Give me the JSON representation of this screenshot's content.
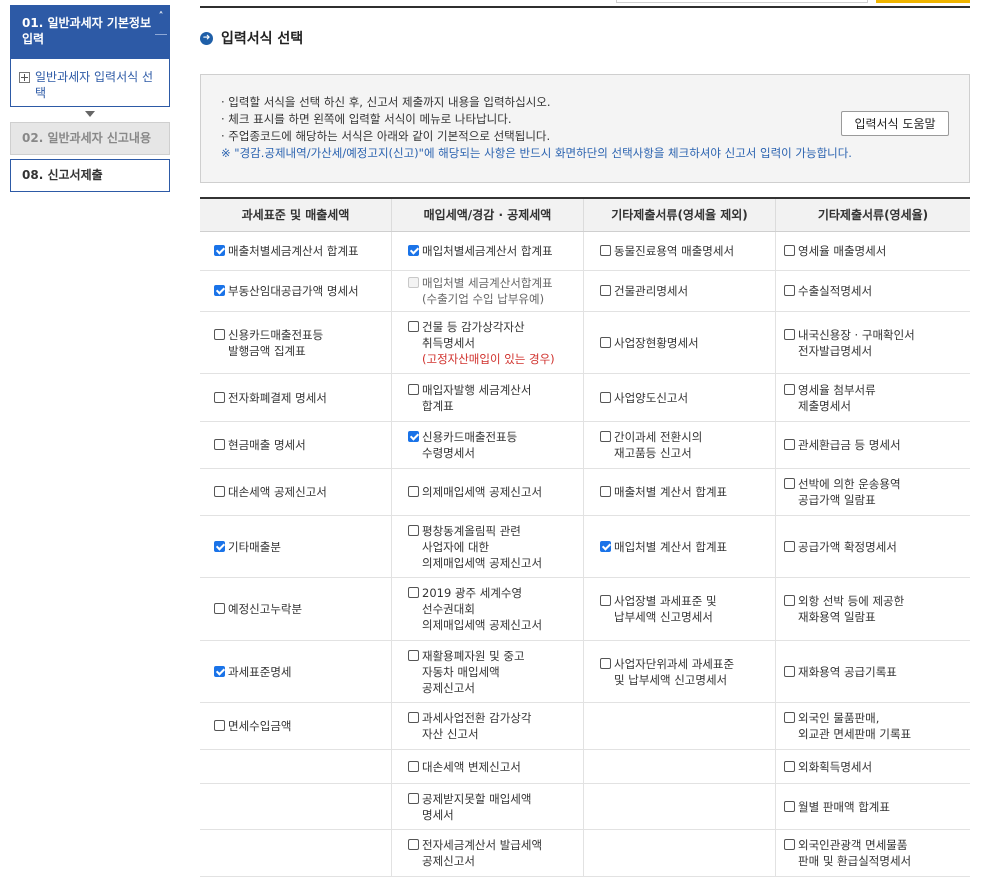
{
  "sidebar": {
    "step1": {
      "num": "01.",
      "label": "일반과세자 기본정보입력",
      "sub_item": "일반과세자 입력서식 선택",
      "collapse_icon": "chevron-up-icon"
    },
    "step2": {
      "num": "02.",
      "label": "일반과세자 신고내용"
    },
    "step8": {
      "num": "08.",
      "label": "신고서제출"
    }
  },
  "section_title": "입력서식 선택",
  "info": {
    "lines": [
      "· 입력할 서식을 선택 하신 후, 신고서 제출까지 내용을 입력하십시오.",
      "· 체크 표시를 하면 왼쪽에 입력할 서식이 메뉴로 나타납니다.",
      "· 주업종코드에 해당하는 서식은 아래와 같이 기본적으로 선택됩니다."
    ],
    "note": "※ \"경감.공제내역/가산세/예정고지(신고)\"에 해당되는 사항은 반드시 화면하단의 선택사항을 체크하셔야 신고서 입력이 가능합니다.",
    "help_button": "입력서식 도움말"
  },
  "colors": {
    "accent": "#2d5aa6",
    "checkbox": "#1a73e8",
    "warning_red": "#d0312d",
    "note_blue": "#2b63b0"
  },
  "table": {
    "headers": [
      "과세표준 및 매출세액",
      "매입세액/경감 · 공제세액",
      "기타제출서류(영세율 제외)",
      "기타제출서류(영세율)"
    ],
    "rows": [
      {
        "h": 38,
        "cells": [
          {
            "lines": [
              "매출처별세금계산서 합계표"
            ],
            "checked": true
          },
          {
            "lines": [
              "매입처별세금계산서 합계표"
            ],
            "checked": true
          },
          {
            "lines": [
              "동물진료용역 매출명세서"
            ],
            "checked": false
          },
          {
            "lines": [
              "영세율 매출명세서"
            ],
            "checked": false
          }
        ]
      },
      {
        "h": 40,
        "cells": [
          {
            "lines": [
              "부동산임대공급가액 명세서"
            ],
            "checked": true
          },
          {
            "lines": [
              "매입처별 세금계산서합계표",
              "(수출기업 수입 납부유예)"
            ],
            "checked": false,
            "disabled": true
          },
          {
            "lines": [
              "건물관리명세서"
            ],
            "checked": false
          },
          {
            "lines": [
              "수출실적명세서"
            ],
            "checked": false
          }
        ]
      },
      {
        "h": 61,
        "cells": [
          {
            "lines": [
              "신용카드매출전표등",
              "발행금액 집계표"
            ],
            "checked": false
          },
          {
            "lines": [
              "건물 등 감가상각자산",
              "취득명세서"
            ],
            "red": "(고정자산매입이 있는 경우)",
            "checked": false
          },
          {
            "lines": [
              "사업장현황명세서"
            ],
            "checked": false
          },
          {
            "lines": [
              "내국신용장 · 구매확인서",
              "전자발급명세서"
            ],
            "checked": false
          }
        ]
      },
      {
        "h": 47,
        "cells": [
          {
            "lines": [
              "전자화폐결제 명세서"
            ],
            "checked": false
          },
          {
            "lines": [
              "매입자발행 세금계산서",
              "합계표"
            ],
            "checked": false
          },
          {
            "lines": [
              "사업양도신고서"
            ],
            "checked": false
          },
          {
            "lines": [
              "영세율 첨부서류",
              "제출명세서"
            ],
            "checked": false
          }
        ]
      },
      {
        "h": 46,
        "cells": [
          {
            "lines": [
              "현금매출 명세서"
            ],
            "checked": false
          },
          {
            "lines": [
              "신용카드매출전표등",
              "수령명세서"
            ],
            "checked": true
          },
          {
            "lines": [
              "간이과세 전환시의",
              "재고품등 신고서"
            ],
            "checked": false
          },
          {
            "lines": [
              "관세환급금 등 명세서"
            ],
            "checked": false
          }
        ]
      },
      {
        "h": 46,
        "cells": [
          {
            "lines": [
              "대손세액 공제신고서"
            ],
            "checked": false
          },
          {
            "lines": [
              "의제매입세액 공제신고서"
            ],
            "checked": false
          },
          {
            "lines": [
              "매출처별 계산서 합계표"
            ],
            "checked": false
          },
          {
            "lines": [
              "선박에 의한 운송용역",
              "공급가액 일람표"
            ],
            "checked": false
          }
        ]
      },
      {
        "h": 61,
        "cells": [
          {
            "lines": [
              "기타매출분"
            ],
            "checked": true
          },
          {
            "lines": [
              "평창동계올림픽 관련",
              "사업자에 대한",
              "의제매입세액 공제신고서"
            ],
            "checked": false
          },
          {
            "lines": [
              "매입처별 계산서 합계표"
            ],
            "checked": true
          },
          {
            "lines": [
              "공급가액 확정명세서"
            ],
            "checked": false
          }
        ]
      },
      {
        "h": 62,
        "cells": [
          {
            "lines": [
              "예정신고누락분"
            ],
            "checked": false
          },
          {
            "lines": [
              "2019 광주 세계수영",
              "선수권대회",
              "의제매입세액 공제신고서"
            ],
            "checked": false
          },
          {
            "lines": [
              "사업장별 과세표준 및",
              "납부세액 신고명세서"
            ],
            "checked": false
          },
          {
            "lines": [
              "외항 선박 등에 제공한",
              "재화용역 일람표"
            ],
            "checked": false
          }
        ]
      },
      {
        "h": 61,
        "cells": [
          {
            "lines": [
              "과세표준명세"
            ],
            "checked": true
          },
          {
            "lines": [
              "재활용폐자원 및 중고",
              "자동차 매입세액",
              "공제신고서"
            ],
            "checked": false
          },
          {
            "lines": [
              "사업자단위과세 과세표준",
              "및 납부세액 신고명세서"
            ],
            "checked": false
          },
          {
            "lines": [
              "재화용역 공급기록표"
            ],
            "checked": false
          }
        ]
      },
      {
        "h": 46,
        "cells": [
          {
            "lines": [
              "면세수입금액"
            ],
            "checked": false
          },
          {
            "lines": [
              "과세사업전환 감가상각",
              "자산 신고서"
            ],
            "checked": false
          },
          null,
          {
            "lines": [
              "외국인 물품판매,",
              "외교관 면세판매 기록표"
            ],
            "checked": false
          }
        ]
      },
      {
        "h": 33,
        "cells": [
          null,
          {
            "lines": [
              "대손세액 변제신고서"
            ],
            "checked": false
          },
          null,
          {
            "lines": [
              "외화획득명세서"
            ],
            "checked": false
          }
        ]
      },
      {
        "h": 45,
        "cells": [
          null,
          {
            "lines": [
              "공제받지못할 매입세액",
              "명세서"
            ],
            "checked": false
          },
          null,
          {
            "lines": [
              "월별 판매액 합계표"
            ],
            "checked": false
          }
        ]
      },
      {
        "h": 46,
        "cells": [
          null,
          {
            "lines": [
              "전자세금계산서 발급세액",
              "공제신고서"
            ],
            "checked": false
          },
          null,
          {
            "lines": [
              "외국인관광객 면세물품",
              "판매 및 환급실적명세서"
            ],
            "checked": false
          }
        ]
      }
    ]
  }
}
